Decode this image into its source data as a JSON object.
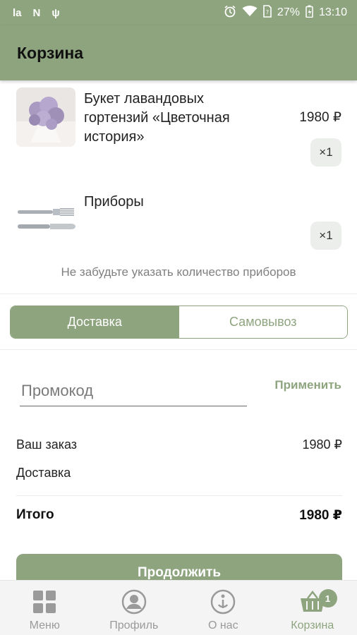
{
  "status_bar": {
    "left_icons": [
      "la-icon",
      "n-icon",
      "usb-icon"
    ],
    "left_text": [
      "la",
      "N",
      "ψ"
    ],
    "battery_percent": "27%",
    "time": "13:10"
  },
  "appbar": {
    "title": "Корзина"
  },
  "cart": {
    "items": [
      {
        "name": "Букет лавандовых гортензий «Цветочная история»",
        "price": "1980 ₽",
        "qty": "×1"
      },
      {
        "name": "Приборы",
        "price": "",
        "qty": "×1"
      }
    ],
    "hint": "Не забудьте указать количество приборов"
  },
  "delivery_toggle": {
    "delivery": "Доставка",
    "pickup": "Самовывоз",
    "selected": "Доставка"
  },
  "promo": {
    "placeholder": "Промокод",
    "value": "",
    "apply_label": "Применить"
  },
  "summary": {
    "order_label": "Ваш заказ",
    "order_value": "1980 ₽",
    "delivery_label": "Доставка",
    "delivery_value": "",
    "total_label": "Итого",
    "total_value": "1980 ₽"
  },
  "continue_label": "Продолжить",
  "bottom_nav": {
    "items": [
      {
        "label": "Меню",
        "icon": "grid-icon"
      },
      {
        "label": "Профиль",
        "icon": "profile-icon"
      },
      {
        "label": "О нас",
        "icon": "info-icon"
      },
      {
        "label": "Корзина",
        "icon": "basket-icon",
        "badge": "1"
      }
    ]
  },
  "colors": {
    "accent": "#8ea47f",
    "text": "#222222",
    "muted": "#808080"
  }
}
